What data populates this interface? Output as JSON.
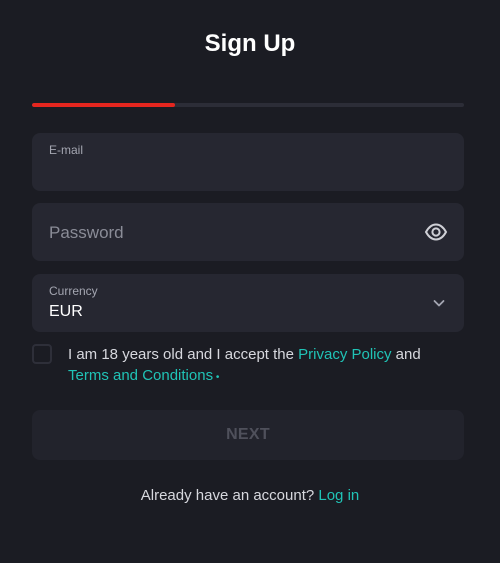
{
  "title": "Sign Up",
  "progress": {
    "fraction": 0.33,
    "color": "#e5261f"
  },
  "email": {
    "label": "E-mail",
    "value": ""
  },
  "password": {
    "placeholder": "Password",
    "icon": "eye-icon"
  },
  "currency": {
    "label": "Currency",
    "value": "EUR",
    "icon": "chevron-down-icon"
  },
  "consent": {
    "prefix": "I am 18 years old and I accept the ",
    "privacy_link": "Privacy Policy",
    "middle": " and ",
    "terms_link": "Terms and Conditions",
    "required_mark": " •",
    "checked": false
  },
  "next_button": {
    "label": "NEXT"
  },
  "login": {
    "prompt": "Already have an account? ",
    "link": "Log in"
  },
  "colors": {
    "background": "#1b1c23",
    "field": "#262731",
    "accent": "#20c3b6",
    "progress": "#e5261f"
  }
}
